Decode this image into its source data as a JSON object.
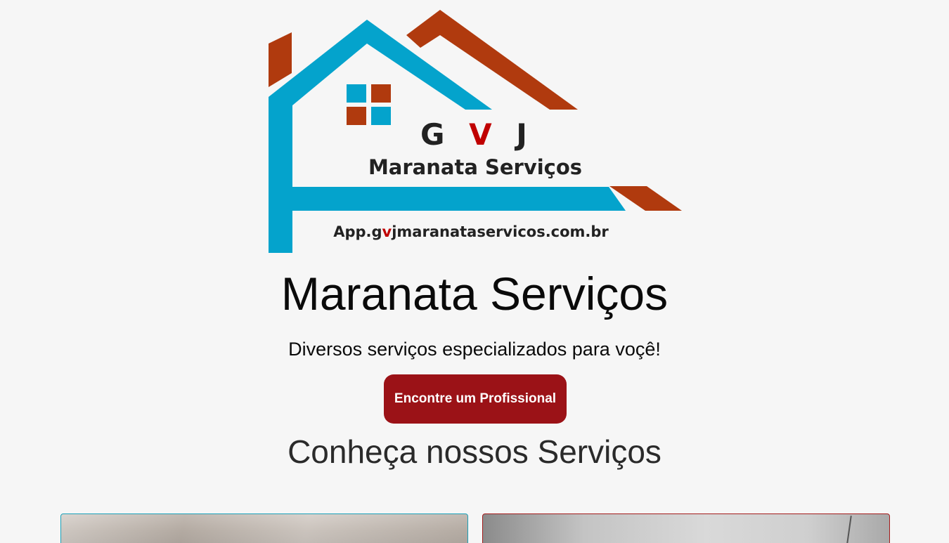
{
  "brand": {
    "logo_initials": [
      "G",
      "V",
      "J"
    ],
    "logo_name": "Maranata Serviços",
    "logo_url_prefix": "App.g",
    "logo_url_accent": "v",
    "logo_url_suffix": "jmaranataservicos.com.br",
    "colors": {
      "blue": "#04a3cc",
      "rust": "#b03a0e",
      "accent_red": "#c00000"
    }
  },
  "hero": {
    "title": "Maranata Serviços",
    "tagline": "Diversos serviços especializados para voçê!",
    "cta_label": "Encontre um Profissional",
    "cta_color": "#9b1217"
  },
  "services": {
    "heading": "Conheça nossos Serviços"
  }
}
